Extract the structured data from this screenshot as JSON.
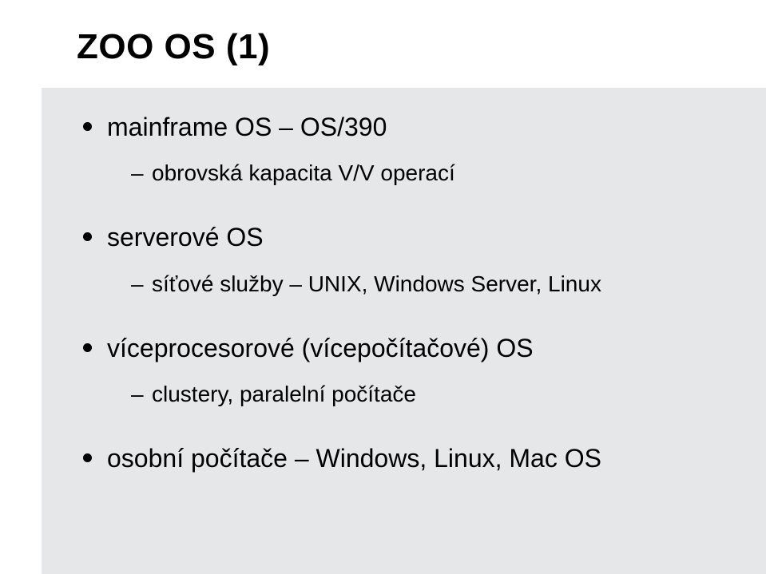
{
  "slide": {
    "title": "ZOO OS (1)",
    "bullets": [
      {
        "text": "mainframe OS – OS/390",
        "sub": [
          {
            "text": "obrovská kapacita V/V operací"
          }
        ]
      },
      {
        "text": "serverové OS",
        "sub": [
          {
            "text": "síťové služby – UNIX, Windows Server, Linux"
          }
        ]
      },
      {
        "text": "víceprocesorové (vícepočítačové) OS",
        "sub": [
          {
            "text": "clustery, paralelní počítače"
          }
        ]
      },
      {
        "text": "osobní počítače – Windows, Linux, Mac OS",
        "sub": []
      }
    ]
  }
}
